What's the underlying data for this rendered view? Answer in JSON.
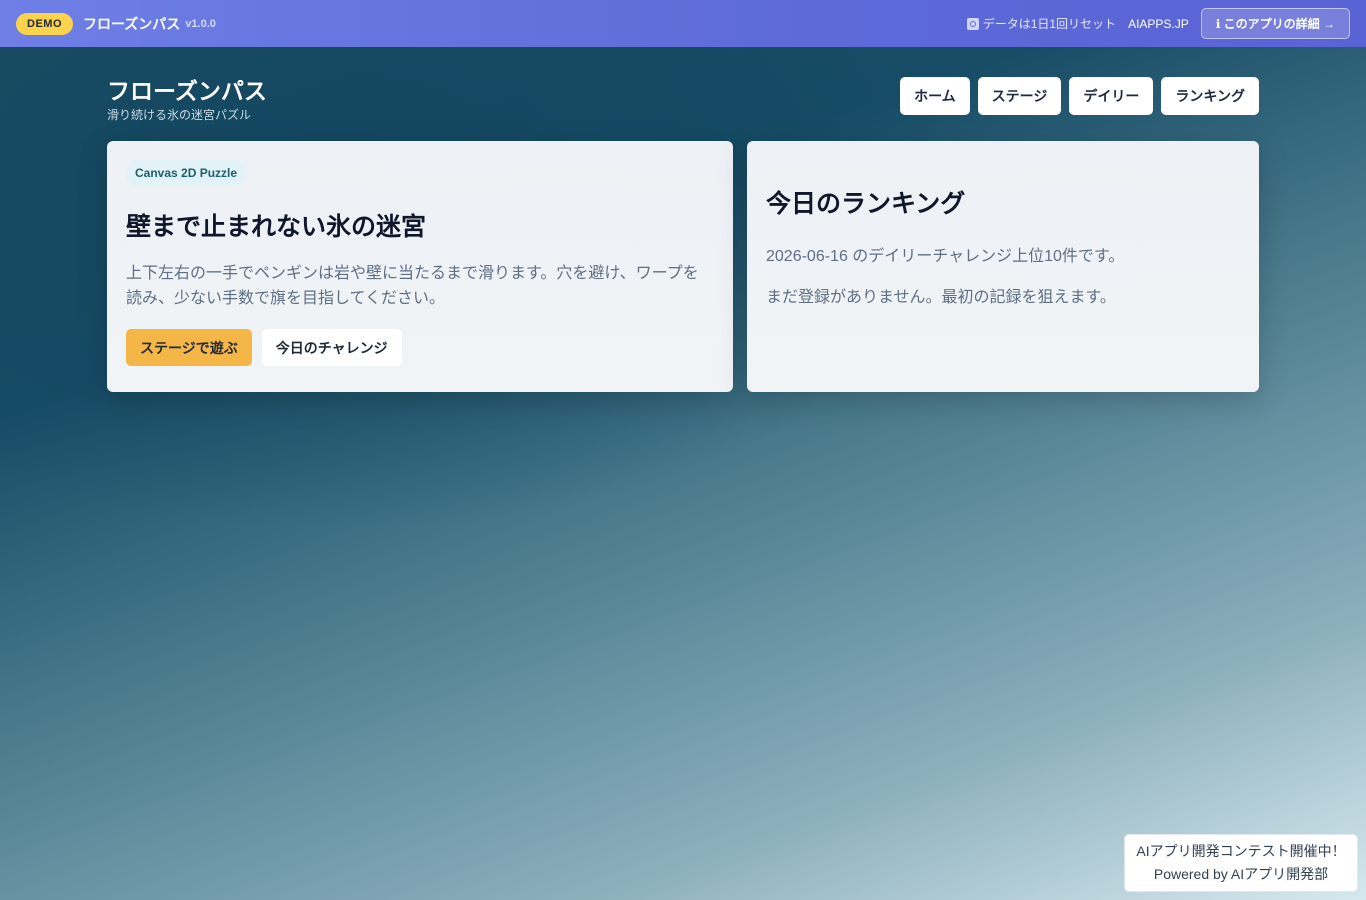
{
  "topbar": {
    "demo_badge": "DEMO",
    "app_name": "フローズンパス",
    "version": "v1.0.0",
    "reset_note": "データは1日1回リセット",
    "site_link": "AIAPPS.JP",
    "detail_button": "ℹ このアプリの詳細 →"
  },
  "header": {
    "title": "フローズンパス",
    "subtitle": "滑り続ける氷の迷宮パズル",
    "nav": [
      "ホーム",
      "ステージ",
      "デイリー",
      "ランキング"
    ]
  },
  "hero": {
    "chip": "Canvas 2D Puzzle",
    "title": "壁まで止まれない氷の迷宮",
    "description": "上下左右の一手でペンギンは岩や壁に当たるまで滑ります。穴を避け、ワープを読み、少ない手数で旗を目指してください。",
    "primary_button": "ステージで遊ぶ",
    "secondary_button": "今日のチャレンジ"
  },
  "ranking": {
    "title": "今日のランキング",
    "description": "2026-06-16 のデイリーチャレンジ上位10件です。",
    "empty_message": "まだ登録がありません。最初の記録を狙えます。"
  },
  "contest": {
    "line1": "AIアプリ開発コンテスト開催中！",
    "line2": "Powered by AIアプリ開発部"
  }
}
